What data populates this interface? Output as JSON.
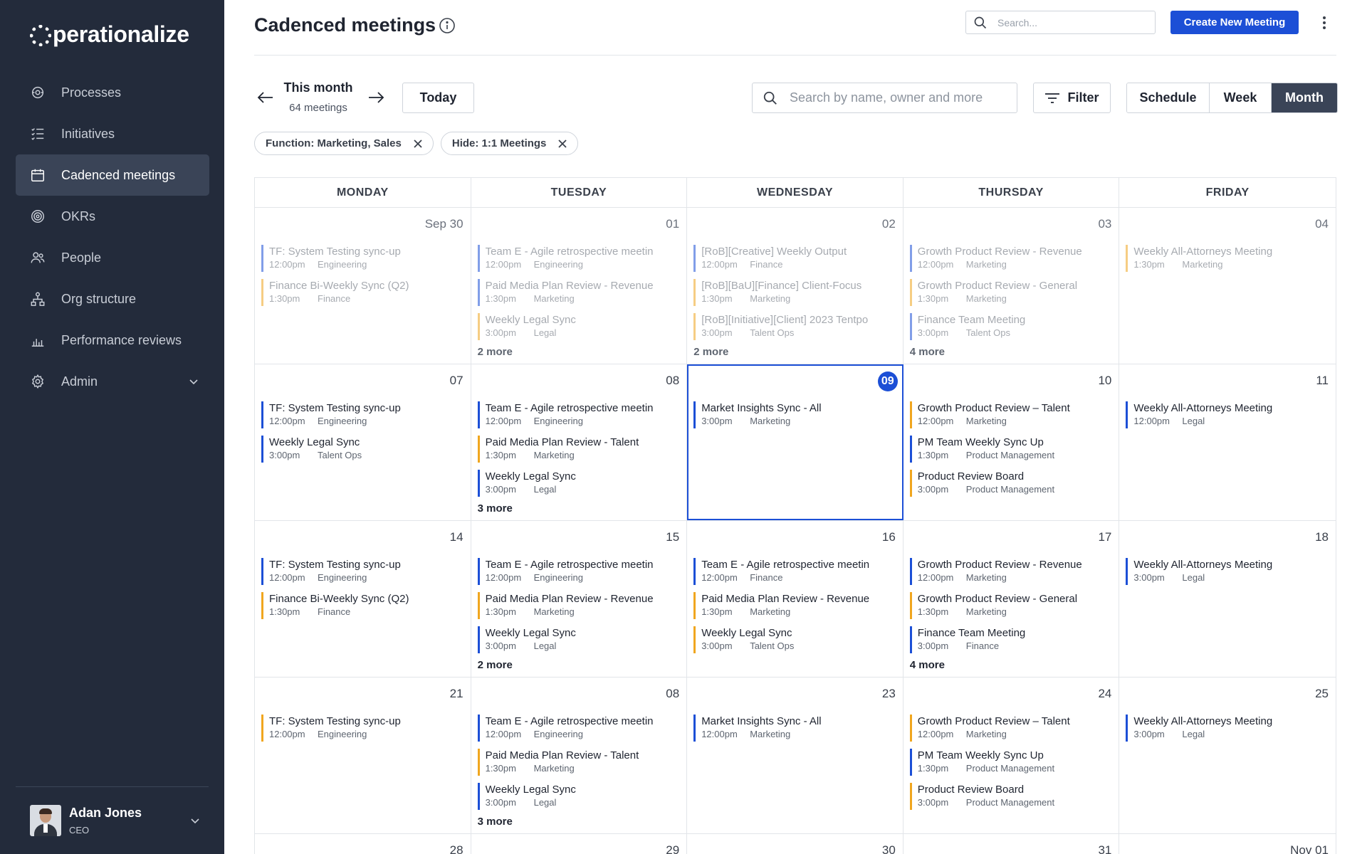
{
  "app": {
    "logo_text": "perationalize",
    "page_title": "Cadenced meetings"
  },
  "sidebar": {
    "items": [
      {
        "label": "Processes",
        "icon": "processes-icon"
      },
      {
        "label": "Initiatives",
        "icon": "list-icon"
      },
      {
        "label": "Cadenced meetings",
        "icon": "calendar-icon"
      },
      {
        "label": "OKRs",
        "icon": "target-icon"
      },
      {
        "label": "People",
        "icon": "people-icon"
      },
      {
        "label": "Org structure",
        "icon": "org-chart-icon"
      },
      {
        "label": "Performance reviews",
        "icon": "bar-chart-icon"
      },
      {
        "label": "Admin",
        "icon": "gear-icon"
      }
    ],
    "user": {
      "name": "Adan Jones",
      "role": "CEO"
    }
  },
  "header": {
    "search_placeholder": "Search...",
    "create_button": "Create New Meeting"
  },
  "toolbar": {
    "period": "This month",
    "count": "64 meetings",
    "today": "Today",
    "search_placeholder": "Search by name, owner and more",
    "filter": "Filter",
    "views": [
      "Schedule",
      "Week",
      "Month"
    ],
    "active_view": "Month",
    "chips": [
      "Function: Marketing, Sales",
      "Hide: 1:1 Meetings"
    ]
  },
  "colors": {
    "accent": "#1c4fd6",
    "sidebar": "#232b3b",
    "orange": "#f0a61f"
  },
  "calendar": {
    "weekdays": [
      "MONDAY",
      "TUESDAY",
      "WEDNESDAY",
      "THURSDAY",
      "FRIDAY"
    ],
    "weeks": [
      [
        {
          "date": "Sep 30",
          "past": true,
          "events": [
            {
              "title": "TF: System Testing sync-up",
              "time": "12:00pm",
              "dept": "Engineering",
              "color": "blue"
            },
            {
              "title": "Finance Bi-Weekly Sync (Q2)",
              "time": "1:30pm",
              "dept": "Finance",
              "color": "orange"
            }
          ]
        },
        {
          "date": "01",
          "past": true,
          "events": [
            {
              "title": "Team E - Agile retrospective meetin",
              "time": "12:00pm",
              "dept": "Engineering",
              "color": "blue"
            },
            {
              "title": "Paid Media Plan Review - Revenue",
              "time": "1:30pm",
              "dept": "Marketing",
              "color": "blue"
            },
            {
              "title": "Weekly Legal Sync",
              "time": "3:00pm",
              "dept": "Legal",
              "color": "orange"
            }
          ],
          "more": "2 more"
        },
        {
          "date": "02",
          "past": true,
          "events": [
            {
              "title": "[RoB][Creative] Weekly Output",
              "time": "12:00pm",
              "dept": "Finance",
              "color": "blue"
            },
            {
              "title": "[RoB][BaU][Finance] Client-Focus",
              "time": "1:30pm",
              "dept": "Marketing",
              "color": "orange"
            },
            {
              "title": "[RoB][Initiative][Client] 2023 Tentpo",
              "time": "3:00pm",
              "dept": "Talent Ops",
              "color": "orange"
            }
          ],
          "more": "2 more"
        },
        {
          "date": "03",
          "past": true,
          "events": [
            {
              "title": "Growth Product Review - Revenue",
              "time": "12:00pm",
              "dept": "Marketing",
              "color": "blue"
            },
            {
              "title": "Growth Product Review - General",
              "time": "1:30pm",
              "dept": "Marketing",
              "color": "orange"
            },
            {
              "title": "Finance Team Meeting",
              "time": "3:00pm",
              "dept": "Talent Ops",
              "color": "blue"
            }
          ],
          "more": "4 more"
        },
        {
          "date": "04",
          "past": true,
          "events": [
            {
              "title": "Weekly All-Attorneys Meeting",
              "time": "1:30pm",
              "dept": "Marketing",
              "color": "orange"
            }
          ]
        }
      ],
      [
        {
          "date": "07",
          "events": [
            {
              "title": "TF: System Testing sync-up",
              "time": "12:00pm",
              "dept": "Engineering",
              "color": "blue"
            },
            {
              "title": "Weekly Legal Sync",
              "time": "3:00pm",
              "dept": "Talent Ops",
              "color": "blue"
            }
          ]
        },
        {
          "date": "08",
          "events": [
            {
              "title": "Team E - Agile retrospective meetin",
              "time": "12:00pm",
              "dept": "Engineering",
              "color": "blue"
            },
            {
              "title": "Paid Media Plan Review - Talent",
              "time": "1:30pm",
              "dept": "Marketing",
              "color": "orange"
            },
            {
              "title": "Weekly Legal Sync",
              "time": "3:00pm",
              "dept": "Legal",
              "color": "blue"
            }
          ],
          "more": "3 more"
        },
        {
          "date": "09",
          "today": true,
          "events": [
            {
              "title": "Market Insights Sync - All",
              "time": "3:00pm",
              "dept": "Marketing",
              "color": "blue"
            }
          ]
        },
        {
          "date": "10",
          "events": [
            {
              "title": "Growth Product Review – Talent",
              "time": "12:00pm",
              "dept": "Marketing",
              "color": "orange"
            },
            {
              "title": "PM Team Weekly Sync Up",
              "time": "1:30pm",
              "dept": "Product Management",
              "color": "blue"
            },
            {
              "title": "Product Review Board",
              "time": "3:00pm",
              "dept": "Product Management",
              "color": "orange"
            }
          ]
        },
        {
          "date": "11",
          "events": [
            {
              "title": "Weekly All-Attorneys Meeting",
              "time": "12:00pm",
              "dept": "Legal",
              "color": "blue"
            }
          ]
        }
      ],
      [
        {
          "date": "14",
          "events": [
            {
              "title": "TF: System Testing sync-up",
              "time": "12:00pm",
              "dept": "Engineering",
              "color": "blue"
            },
            {
              "title": "Finance Bi-Weekly Sync (Q2)",
              "time": "1:30pm",
              "dept": "Finance",
              "color": "orange"
            }
          ]
        },
        {
          "date": "15",
          "events": [
            {
              "title": "Team E - Agile retrospective meetin",
              "time": "12:00pm",
              "dept": "Engineering",
              "color": "blue"
            },
            {
              "title": "Paid Media Plan Review - Revenue",
              "time": "1:30pm",
              "dept": "Marketing",
              "color": "orange"
            },
            {
              "title": "Weekly Legal Sync",
              "time": "3:00pm",
              "dept": "Legal",
              "color": "blue"
            }
          ],
          "more": "2 more"
        },
        {
          "date": "16",
          "events": [
            {
              "title": "Team E - Agile retrospective meetin",
              "time": "12:00pm",
              "dept": "Finance",
              "color": "blue"
            },
            {
              "title": "Paid Media Plan Review - Revenue",
              "time": "1:30pm",
              "dept": "Marketing",
              "color": "orange"
            },
            {
              "title": "Weekly Legal Sync",
              "time": "3:00pm",
              "dept": "Talent Ops",
              "color": "orange"
            }
          ]
        },
        {
          "date": "17",
          "events": [
            {
              "title": "Growth Product Review - Revenue",
              "time": "12:00pm",
              "dept": "Marketing",
              "color": "blue"
            },
            {
              "title": "Growth Product Review - General",
              "time": "1:30pm",
              "dept": "Marketing",
              "color": "orange"
            },
            {
              "title": "Finance Team Meeting",
              "time": "3:00pm",
              "dept": "Finance",
              "color": "blue"
            }
          ],
          "more": "4 more"
        },
        {
          "date": "18",
          "events": [
            {
              "title": "Weekly All-Attorneys Meeting",
              "time": "3:00pm",
              "dept": "Legal",
              "color": "blue"
            }
          ]
        }
      ],
      [
        {
          "date": "21",
          "events": [
            {
              "title": "TF: System Testing sync-up",
              "time": "12:00pm",
              "dept": "Engineering",
              "color": "orange"
            }
          ]
        },
        {
          "date": "08",
          "events": [
            {
              "title": "Team E - Agile retrospective meetin",
              "time": "12:00pm",
              "dept": "Engineering",
              "color": "blue"
            },
            {
              "title": "Paid Media Plan Review - Talent",
              "time": "1:30pm",
              "dept": "Marketing",
              "color": "orange"
            },
            {
              "title": "Weekly Legal Sync",
              "time": "3:00pm",
              "dept": "Legal",
              "color": "blue"
            }
          ],
          "more": "3 more"
        },
        {
          "date": "23",
          "events": [
            {
              "title": "Market Insights Sync - All",
              "time": "12:00pm",
              "dept": "Marketing",
              "color": "blue"
            }
          ]
        },
        {
          "date": "24",
          "events": [
            {
              "title": "Growth Product Review – Talent",
              "time": "12:00pm",
              "dept": "Marketing",
              "color": "orange"
            },
            {
              "title": "PM Team Weekly Sync Up",
              "time": "1:30pm",
              "dept": "Product Management",
              "color": "blue"
            },
            {
              "title": "Product Review Board",
              "time": "3:00pm",
              "dept": "Product Management",
              "color": "orange"
            }
          ]
        },
        {
          "date": "25",
          "events": [
            {
              "title": "Weekly All-Attorneys Meeting",
              "time": "3:00pm",
              "dept": "Legal",
              "color": "blue"
            }
          ]
        }
      ],
      [
        {
          "date": "28",
          "events": []
        },
        {
          "date": "29",
          "events": []
        },
        {
          "date": "30",
          "events": []
        },
        {
          "date": "31",
          "events": []
        },
        {
          "date": "Nov 01",
          "events": []
        }
      ]
    ]
  }
}
